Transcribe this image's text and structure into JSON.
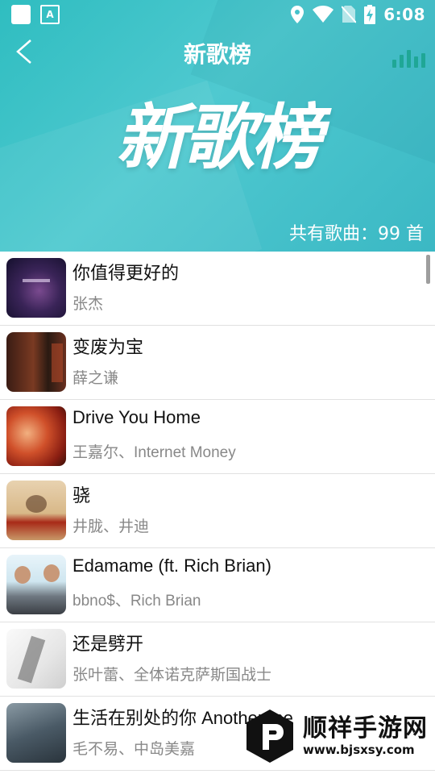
{
  "status_bar": {
    "time": "6:08",
    "a_glyph": "A"
  },
  "header": {
    "title": "新歌榜",
    "banner_text": "新歌榜",
    "song_count": "共有歌曲：99 首",
    "colors": {
      "gradient_start": "#2fbdc0",
      "gradient_end": "#3bb8c4",
      "eq_icon": "#1fa796"
    }
  },
  "songs": [
    {
      "title": "你值得更好的",
      "artist": "张杰"
    },
    {
      "title": "变废为宝",
      "artist": "薛之谦"
    },
    {
      "title": "Drive You Home",
      "artist": "王嘉尔、Internet Money"
    },
    {
      "title": "骁",
      "artist": "井胧、井迪"
    },
    {
      "title": "Edamame (ft. Rich Brian)",
      "artist": "bbno$、Rich Brian"
    },
    {
      "title": "还是劈开",
      "artist": "张叶蕾、全体诺克萨斯国战士"
    },
    {
      "title": "生活在别处的你 Another me",
      "artist": "毛不易、中岛美嘉"
    }
  ],
  "watermark": {
    "name": "顺祥手游网",
    "url": "www.bjsxsy.com"
  }
}
